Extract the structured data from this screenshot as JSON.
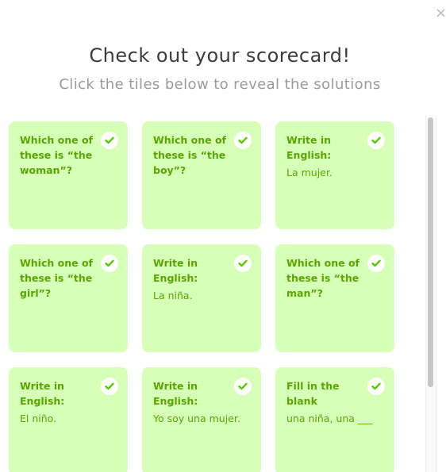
{
  "modal": {
    "close_label": "×",
    "title": "Check out your scorecard!",
    "subtitle": "Click the tiles below to reveal the solutions"
  },
  "colors": {
    "tile_background": "#d7ffb8",
    "tile_text": "#58a700",
    "check_icon": "#58cc02"
  },
  "tiles": [
    {
      "prompt": "Which one of these is “the woman”?",
      "answer": "",
      "icon": "check-icon"
    },
    {
      "prompt": "Which one of these is “the boy”?",
      "answer": "",
      "icon": "check-icon"
    },
    {
      "prompt": "Write in English:",
      "answer": "La mujer.",
      "icon": "check-icon"
    },
    {
      "prompt": "Which one of these is “the girl”?",
      "answer": "",
      "icon": "check-icon"
    },
    {
      "prompt": "Write in English:",
      "answer": "La niña.",
      "icon": "check-icon"
    },
    {
      "prompt": "Which one of these is “the man”?",
      "answer": "",
      "icon": "check-icon"
    },
    {
      "prompt": "Write in English:",
      "answer": "El niño.",
      "icon": "check-icon"
    },
    {
      "prompt": "Write in English:",
      "answer": "Yo soy una mujer.",
      "icon": "check-icon"
    },
    {
      "prompt": "Fill in the blank",
      "answer": "una niña, una ___",
      "icon": "check-icon"
    }
  ]
}
